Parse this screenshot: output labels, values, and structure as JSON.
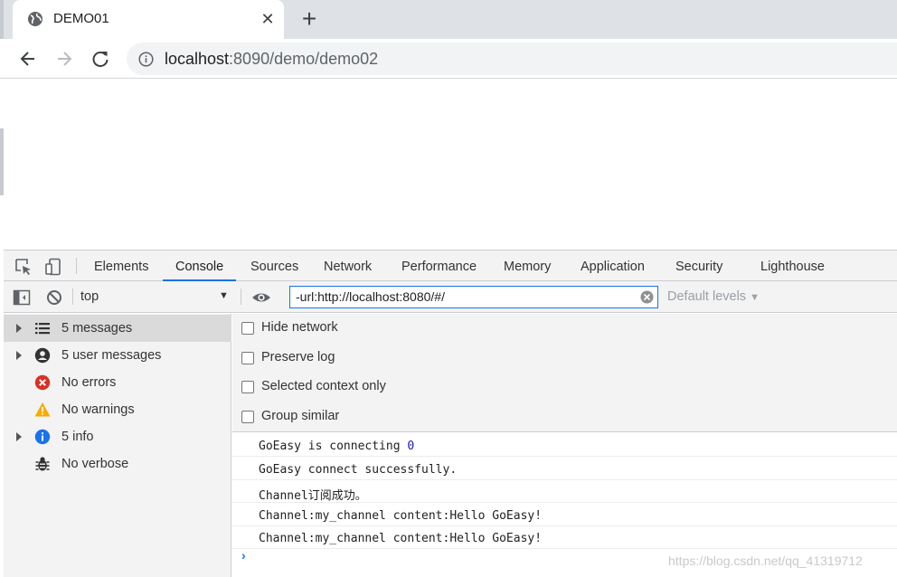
{
  "browser": {
    "tab_title": "DEMO01",
    "url_host": "localhost",
    "url_rest": ":8090/demo/demo02"
  },
  "devtools": {
    "tabs": [
      "Elements",
      "Console",
      "Sources",
      "Network",
      "Performance",
      "Memory",
      "Application",
      "Security",
      "Lighthouse"
    ],
    "active_tab": "Console",
    "context": "top",
    "filter_value": "-url:http://localhost:8080/#/",
    "levels": "Default levels",
    "sidebar": [
      {
        "label": "5 messages",
        "icon": "list-icon"
      },
      {
        "label": "5 user messages",
        "icon": "user-icon"
      },
      {
        "label": "No errors",
        "icon": "error-icon"
      },
      {
        "label": "No warnings",
        "icon": "warning-icon"
      },
      {
        "label": "5 info",
        "icon": "info-icon"
      },
      {
        "label": "No verbose",
        "icon": "bug-icon"
      }
    ],
    "settings": [
      "Hide network",
      "Preserve log",
      "Selected context only",
      "Group similar"
    ],
    "logs": [
      {
        "text": "GoEasy is connecting ",
        "num": "0"
      },
      {
        "text": "GoEasy connect successfully.",
        "num": ""
      },
      {
        "text": "Channel订阅成功。",
        "num": ""
      },
      {
        "text": "Channel:my_channel content:Hello GoEasy!",
        "num": ""
      },
      {
        "text": "Channel:my_channel content:Hello GoEasy!",
        "num": ""
      }
    ],
    "prompt": "›"
  },
  "watermark": "https://blog.csdn.net/qq_41319712",
  "colors": {
    "accent": "#1a73e8",
    "error": "#d93025",
    "warning": "#f9ab00",
    "info": "#1a73e8"
  }
}
